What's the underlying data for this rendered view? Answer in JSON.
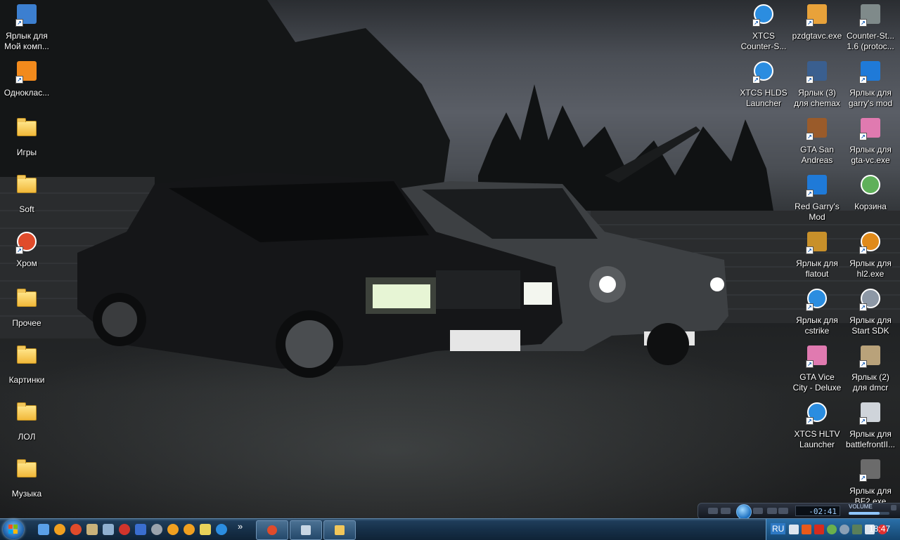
{
  "desktop": {
    "left_icons": [
      {
        "label": "Ярлык для\nМой комп...",
        "icon": "my-computer-icon",
        "color": "#3c7fd0"
      },
      {
        "label": "Одноклас...",
        "icon": "odnoklassniki-icon",
        "color": "#f28a1c"
      },
      {
        "label": "Игры",
        "icon": "folder-icon",
        "color": "#f1c65a"
      },
      {
        "label": "Soft",
        "icon": "folder-icon",
        "color": "#f1c65a"
      },
      {
        "label": "Хром",
        "icon": "chrome-icon",
        "color": "#e04b2b"
      },
      {
        "label": "Прочее",
        "icon": "folder-icon",
        "color": "#f1c65a"
      },
      {
        "label": "Картинки",
        "icon": "folder-icon",
        "color": "#f1c65a"
      },
      {
        "label": "ЛОЛ",
        "icon": "folder-icon",
        "color": "#f1c65a"
      },
      {
        "label": "Музыка",
        "icon": "folder-icon",
        "color": "#f1c65a"
      }
    ],
    "right_icons": [
      {
        "label": "XTCS\nCounter-S...",
        "icon": "steam-lambda-icon",
        "color": "#2b8de0"
      },
      {
        "label": "pzdgtavc.exe",
        "icon": "pizza-icon",
        "color": "#e8a23a"
      },
      {
        "label": "Counter-St...\n1.6 (protoc...",
        "icon": "counter-strike-icon",
        "color": "#7f8a8a"
      },
      {
        "label": "XTCS HLDS\nLauncher",
        "icon": "steam-lambda-icon",
        "color": "#2b8de0"
      },
      {
        "label": "Ярлык (3)\nдля chemax",
        "icon": "chemax-icon",
        "color": "#3a5f8f"
      },
      {
        "label": "Ярлык для\ngarry's mod",
        "icon": "garrys-mod-icon",
        "color": "#1f7ad8"
      },
      {
        "label": "GTA San\nAndreas",
        "icon": "gta-sa-icon",
        "color": "#9a5b2a"
      },
      {
        "label": "Ярлык для\ngta-vc.exe",
        "icon": "gta-vc-icon",
        "color": "#e07ab0"
      },
      {
        "label": "Red Garry's\nMod",
        "icon": "garrys-mod-icon",
        "color": "#1f7ad8"
      },
      {
        "label": "Корзина",
        "icon": "recycle-bin-icon",
        "color": "#5fb05a"
      },
      {
        "label": "Ярлык для\nflatout",
        "icon": "flatout-icon",
        "color": "#c8902a"
      },
      {
        "label": "Ярлык для\nhl2.exe",
        "icon": "half-life-2-icon",
        "color": "#e08a1a"
      },
      {
        "label": "Ярлык для\ncstrike",
        "icon": "steam-lambda-icon",
        "color": "#2b8de0"
      },
      {
        "label": "Ярлык для\nStart SDK",
        "icon": "sdk-icon",
        "color": "#8d98a6"
      },
      {
        "label": "GTA Vice\nCity - Deluxe",
        "icon": "gta-vc-icon",
        "color": "#e07ab0"
      },
      {
        "label": "Ярлык (2)\nдля dmcr",
        "icon": "dmcr-icon",
        "color": "#b9a27a"
      },
      {
        "label": "XTCS HLTV\nLauncher",
        "icon": "hltv-icon",
        "color": "#2b8de0"
      },
      {
        "label": "Ярлык для\nbattlefrontII...",
        "icon": "battlefront-icon",
        "color": "#cfd4da"
      },
      {
        "label": "Ярлык для\nBF2.exe",
        "icon": "battlefield-icon",
        "color": "#6b6b6b"
      }
    ]
  },
  "media_player": {
    "time": "-02:41",
    "volume_label": "VOLUME",
    "volume_level": 0.75
  },
  "taskbar": {
    "quick_launch": [
      {
        "icon": "show-desktop-icon",
        "color": "#5aa0e8"
      },
      {
        "icon": "half-life-icon",
        "color": "#f0a020"
      },
      {
        "icon": "chrome-icon",
        "color": "#e04b2b"
      },
      {
        "icon": "game-icon",
        "color": "#c9b27a"
      },
      {
        "icon": "computer-icon",
        "color": "#8fb0d0"
      },
      {
        "icon": "media-icon",
        "color": "#d0342c"
      },
      {
        "icon": "save-icon",
        "color": "#3a6ecf"
      },
      {
        "icon": "disc-icon",
        "color": "#9aa3ad"
      },
      {
        "icon": "half-life-2-icon",
        "color": "#f0a020"
      },
      {
        "icon": "half-life-icon",
        "color": "#f0a020"
      },
      {
        "icon": "notes-icon",
        "color": "#e8d35a"
      },
      {
        "icon": "steam-lambda-icon",
        "color": "#2b8de0"
      }
    ],
    "overflow": "»",
    "tasks": [
      {
        "icon": "chrome-icon",
        "color": "#e04b2b"
      },
      {
        "icon": "explorer-icon",
        "color": "#c8d6e4"
      },
      {
        "icon": "folder-icon",
        "color": "#f1c65a"
      }
    ],
    "tray": {
      "lang": "RU",
      "clock": "18:47",
      "icons": [
        {
          "icon": "show-hidden-icon",
          "color": "#dde6ef"
        },
        {
          "icon": "media-tray-icon",
          "color": "#e85a1a"
        },
        {
          "icon": "russian-flag-icon",
          "color": "#d52b1e"
        },
        {
          "icon": "network-icon",
          "color": "#6ab04c"
        },
        {
          "icon": "globe-icon",
          "color": "#8aa0b5"
        },
        {
          "icon": "display-icon",
          "color": "#5a7f5a"
        },
        {
          "icon": "volume-icon",
          "color": "#dde6ef"
        },
        {
          "icon": "opera-icon",
          "color": "#e03030"
        }
      ]
    }
  }
}
